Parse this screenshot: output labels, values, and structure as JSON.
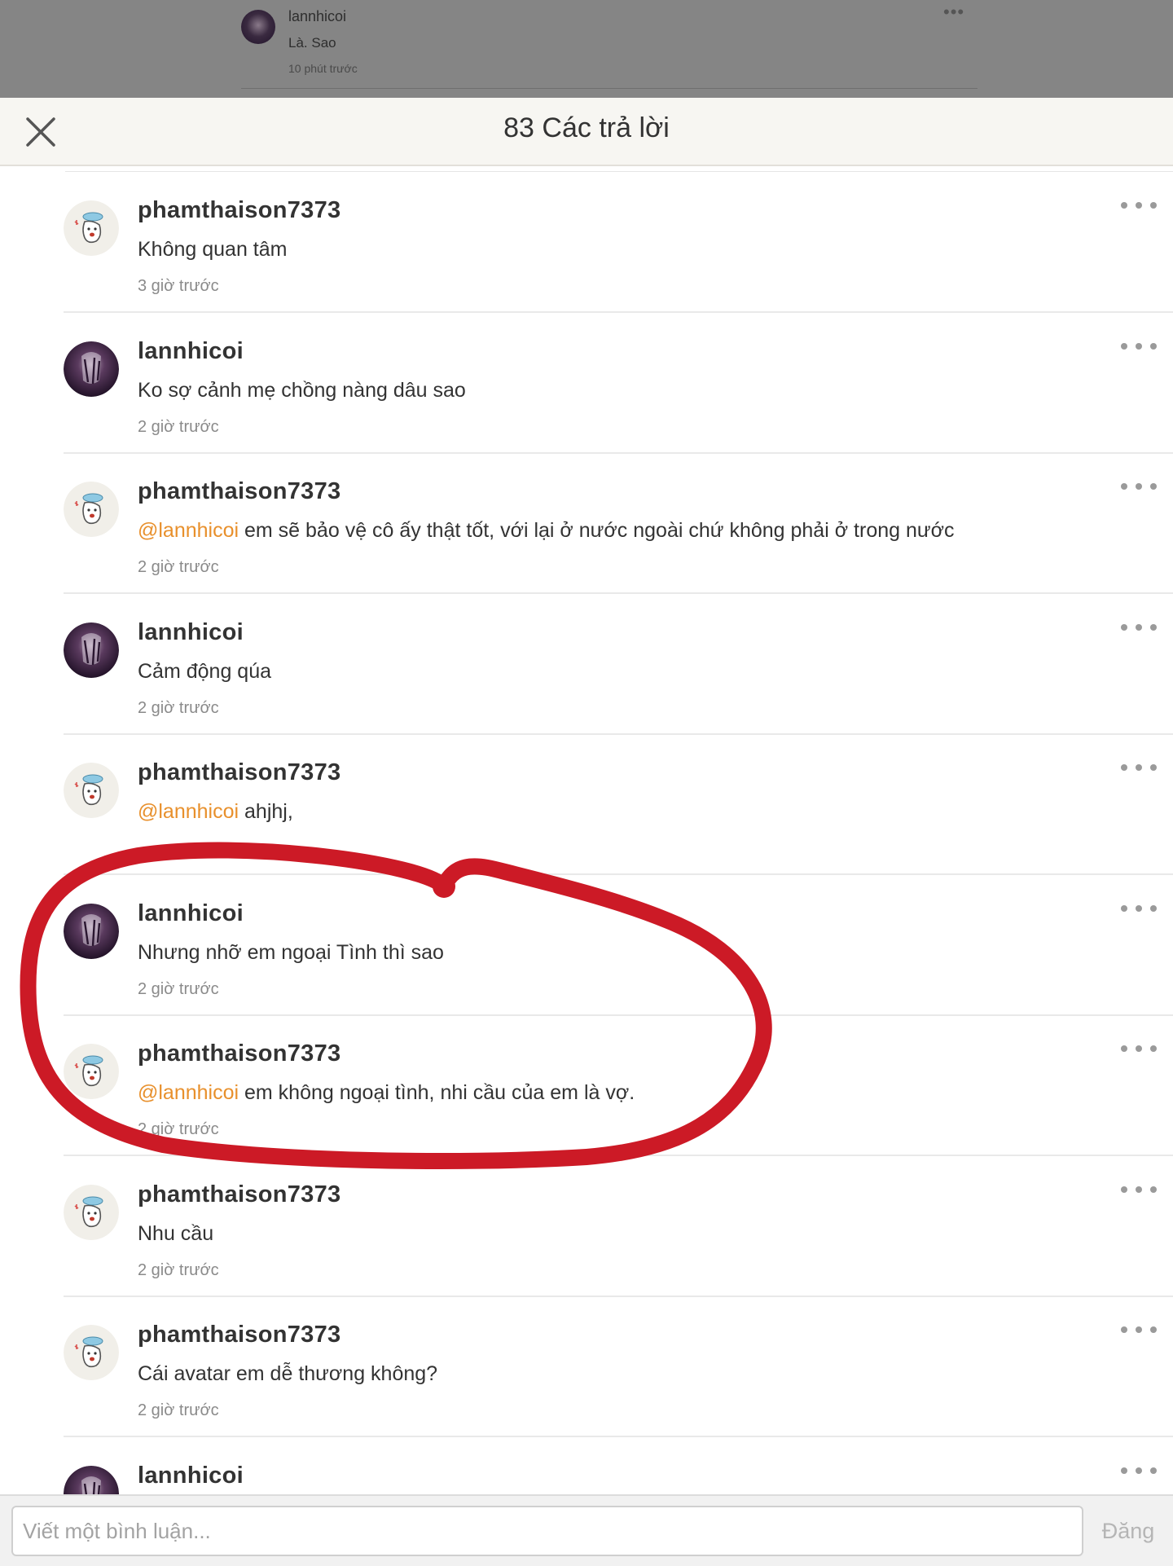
{
  "background_post": {
    "username": "lannhicoi",
    "text": "Là. Sao",
    "time": "10 phút trước"
  },
  "header": {
    "title": "83 Các trả lời"
  },
  "comments": [
    {
      "avatar": "cartoon",
      "username": "phamthaison7373",
      "mention": "",
      "text": "Không quan tâm",
      "time": "3 giờ trước"
    },
    {
      "avatar": "anime",
      "username": "lannhicoi",
      "mention": "",
      "text": "Ko sợ cảnh mẹ chồng nàng dâu sao",
      "time": "2 giờ trước"
    },
    {
      "avatar": "cartoon",
      "username": "phamthaison7373",
      "mention": "@lannhicoi",
      "text": " em sẽ bảo vệ cô ấy thật tốt, với lại ở nước ngoài chứ không phải ở trong nước",
      "time": "2 giờ trước"
    },
    {
      "avatar": "anime",
      "username": "lannhicoi",
      "mention": "",
      "text": "Cảm động qúa",
      "time": "2 giờ trước"
    },
    {
      "avatar": "cartoon",
      "username": "phamthaison7373",
      "mention": "@lannhicoi",
      "text": " ahjhj,",
      "time": ""
    },
    {
      "avatar": "anime",
      "username": "lannhicoi",
      "mention": "",
      "text": "Nhưng nhỡ em ngoại Tình thì sao",
      "time": "2 giờ trước"
    },
    {
      "avatar": "cartoon",
      "username": "phamthaison7373",
      "mention": "@lannhicoi",
      "text": " em không ngoại tình, nhi cầu của em là vợ.",
      "time": "2 giờ trước"
    },
    {
      "avatar": "cartoon",
      "username": "phamthaison7373",
      "mention": "",
      "text": "Nhu cầu",
      "time": "2 giờ trước"
    },
    {
      "avatar": "cartoon",
      "username": "phamthaison7373",
      "mention": "",
      "text": "Cái avatar em dễ thương không?",
      "time": "2 giờ trước"
    },
    {
      "avatar": "anime",
      "username": "lannhicoi",
      "mention": "",
      "text": "",
      "time": ""
    }
  ],
  "input": {
    "placeholder": "Viết một bình luận...",
    "value": "",
    "post_label": "Đăng"
  },
  "colors": {
    "mention": "#e8902c",
    "annotation": "#cc1a26",
    "header_bg": "#f7f6f2",
    "backdrop": "#858585"
  }
}
